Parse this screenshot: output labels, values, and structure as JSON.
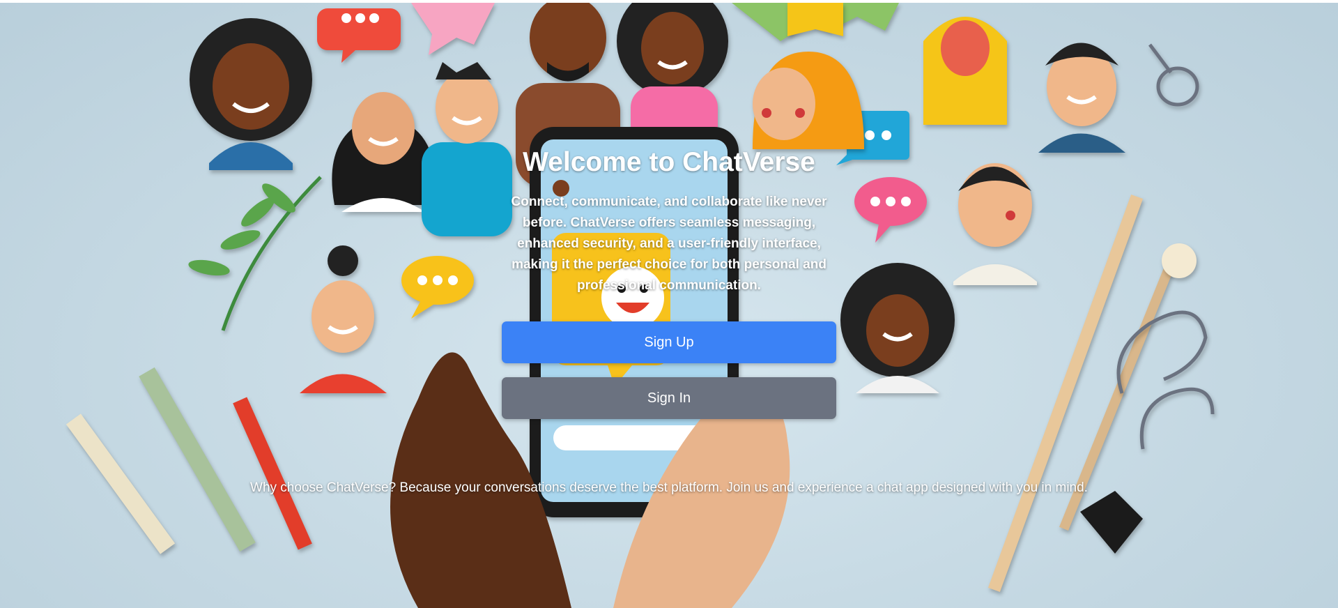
{
  "hero": {
    "title": "Welcome to ChatVerse",
    "description": "Connect, communicate, and collaborate like never before. ChatVerse offers seamless messaging, enhanced security, and a user-friendly interface, making it the perfect choice for both personal and professional communication.",
    "tagline": "Why choose ChatVerse? Because your conversations deserve the best platform. Join us and experience a chat app designed with you in mind."
  },
  "actions": {
    "signup_label": "Sign Up",
    "signin_label": "Sign In"
  },
  "colors": {
    "primary": "#3b82f6",
    "secondary": "#6b7280",
    "background": "#c8dbe5"
  },
  "icons": [
    "chat-bubble-icon",
    "smiley-icon"
  ]
}
